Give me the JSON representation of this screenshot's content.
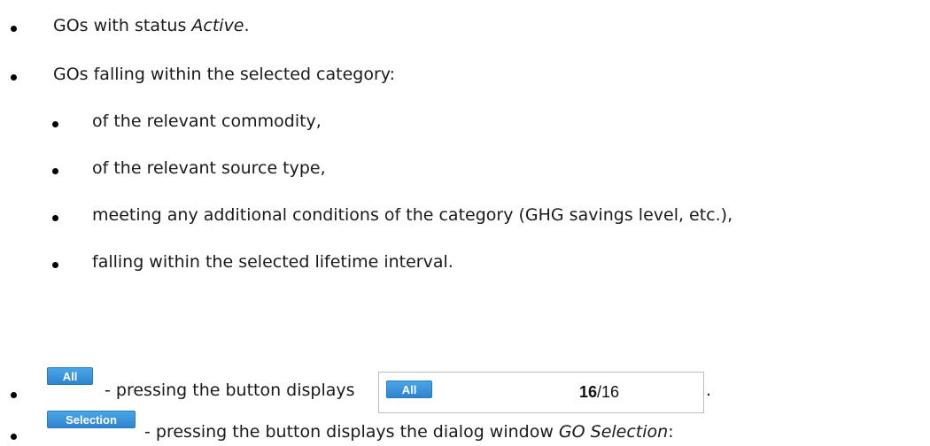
{
  "items": [
    {
      "pre": "GOs with status ",
      "em": "Active",
      "post": "."
    },
    {
      "text": "GOs falling within the selected category:"
    },
    {
      "text": "of the relevant commodity,"
    },
    {
      "text": "of the relevant source type,"
    },
    {
      "text": "meeting any additional conditions of the category (GHG savings level, etc.),"
    },
    {
      "text": "falling within the selected lifetime interval."
    }
  ],
  "all_item": {
    "button_label": "All",
    "desc_pre": "- pressing the button displays",
    "desc_post": ".",
    "counter": {
      "selected": "16",
      "sep_total": "/16"
    }
  },
  "selection_item": {
    "button_label": "Selection",
    "desc_pre": "- pressing the button displays the dialog window ",
    "desc_em": "GO Selection",
    "desc_post": ":"
  },
  "colors": {
    "button_blue": "#3a93db",
    "text": "#1a1a1a"
  }
}
